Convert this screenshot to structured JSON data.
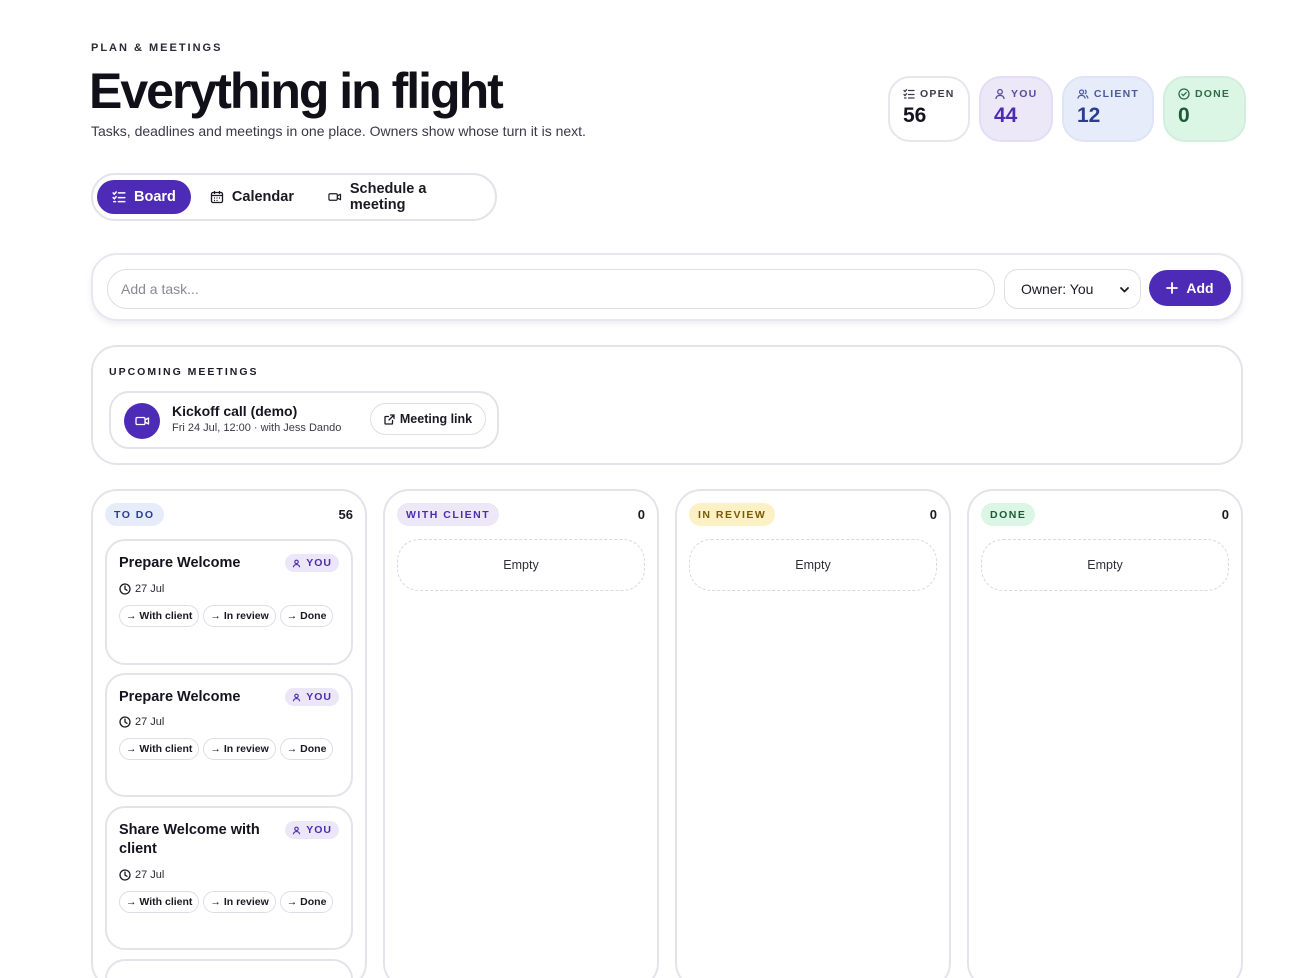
{
  "header": {
    "eyebrow": "PLAN & MEETINGS",
    "title": "Everything in flight",
    "subtitle": "Tasks, deadlines and meetings in one place. Owners show whose turn it is next."
  },
  "stats": {
    "open": {
      "label": "OPEN",
      "value": "56",
      "icon": "checklist-icon"
    },
    "you": {
      "label": "YOU",
      "value": "44",
      "icon": "user-icon"
    },
    "client": {
      "label": "CLIENT",
      "value": "12",
      "icon": "users-icon"
    },
    "done": {
      "label": "DONE",
      "value": "0",
      "icon": "check-circle-icon"
    }
  },
  "tabs": [
    {
      "label": "Board",
      "icon": "checklist-icon",
      "active": true
    },
    {
      "label": "Calendar",
      "icon": "calendar-icon",
      "active": false
    },
    {
      "label": "Schedule a meeting",
      "icon": "video-icon",
      "active": false
    }
  ],
  "add_task": {
    "placeholder": "Add a task...",
    "owner_selected": "Owner: You",
    "add_label": "Add"
  },
  "meetings": {
    "title": "UPCOMING MEETINGS",
    "items": [
      {
        "title": "Kickoff call (demo)",
        "sub": "Fri 24 Jul, 12:00 · with Jess Dando",
        "link_label": "Meeting link"
      }
    ]
  },
  "colors": {
    "accent": "#4d2bb6",
    "todo_pill": "#e6ecfa",
    "with_client_pill": "#ece8f8",
    "in_review_pill": "#fbf1c4",
    "done_pill": "#dcf6e6"
  },
  "board": {
    "columns": [
      {
        "label": "TO DO",
        "count": "56"
      },
      {
        "label": "WITH CLIENT",
        "count": "0",
        "empty": "Empty"
      },
      {
        "label": "IN REVIEW",
        "count": "0",
        "empty": "Empty"
      },
      {
        "label": "DONE",
        "count": "0",
        "empty": "Empty"
      }
    ],
    "cards": [
      {
        "title": "Prepare Welcome",
        "owner": "YOU",
        "due": "27 Jul",
        "moves": [
          "→ With client",
          "→ In review",
          "→ Done"
        ]
      },
      {
        "title": "Prepare Welcome",
        "owner": "YOU",
        "due": "27 Jul",
        "moves": [
          "→ With client",
          "→ In review",
          "→ Done"
        ]
      },
      {
        "title": "Share Welcome with client",
        "owner": "YOU",
        "due": "27 Jul",
        "moves": [
          "→ With client",
          "→ In review",
          "→ Done"
        ]
      }
    ]
  }
}
